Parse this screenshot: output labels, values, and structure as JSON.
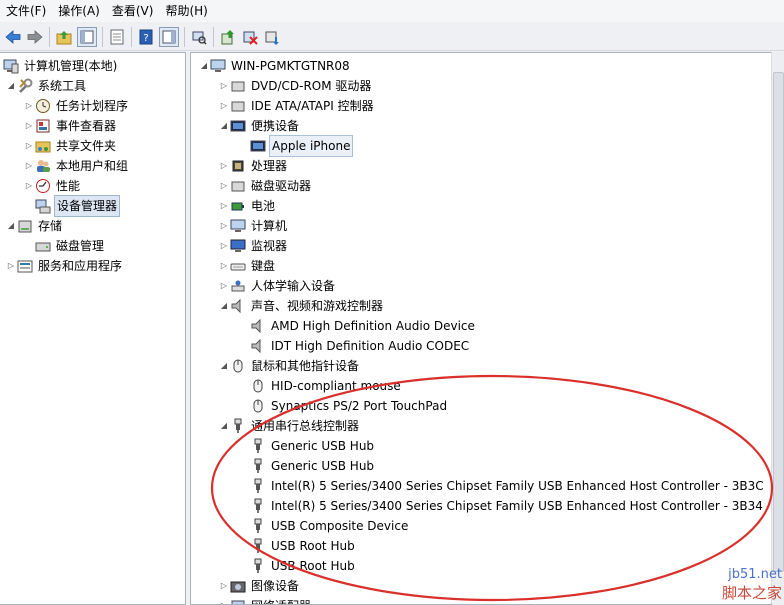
{
  "menu": [
    "文件(F)",
    "操作(A)",
    "查看(V)",
    "帮助(H)"
  ],
  "toolbar": {
    "icons": [
      "back-arrow-icon",
      "forward-arrow-icon",
      "up-folder-icon",
      "show-hide-tree-icon",
      "properties-icon",
      "help-icon",
      "action-pane-icon",
      "scan-hardware-icon",
      "update-driver-icon",
      "disable-device-icon",
      "uninstall-device-icon"
    ]
  },
  "left_tree": {
    "root": "计算机管理(本地)",
    "system_tools": "系统工具",
    "task_scheduler": "任务计划程序",
    "event_viewer": "事件查看器",
    "shared_folders": "共享文件夹",
    "local_users": "本地用户和组",
    "performance": "性能",
    "device_manager": "设备管理器",
    "storage": "存储",
    "disk_management": "磁盘管理",
    "services": "服务和应用程序"
  },
  "device_tree": {
    "computer": "WIN-PGMKTGTNR08",
    "categories": [
      {
        "label": "DVD/CD-ROM 驱动器",
        "expanded": false
      },
      {
        "label": "IDE ATA/ATAPI 控制器",
        "expanded": false
      },
      {
        "label": "便携设备",
        "expanded": true,
        "children": [
          "Apple iPhone"
        ]
      },
      {
        "label": "处理器",
        "expanded": false
      },
      {
        "label": "磁盘驱动器",
        "expanded": false
      },
      {
        "label": "电池",
        "expanded": false
      },
      {
        "label": "计算机",
        "expanded": false
      },
      {
        "label": "监视器",
        "expanded": false
      },
      {
        "label": "键盘",
        "expanded": false
      },
      {
        "label": "人体学输入设备",
        "expanded": false
      },
      {
        "label": "声音、视频和游戏控制器",
        "expanded": true,
        "children": [
          "AMD High Definition Audio Device",
          "IDT High Definition Audio CODEC"
        ]
      },
      {
        "label": "鼠标和其他指针设备",
        "expanded": true,
        "children": [
          "HID-compliant mouse",
          "Synaptics PS/2 Port TouchPad"
        ]
      },
      {
        "label": "通用串行总线控制器",
        "expanded": true,
        "children": [
          "Generic USB Hub",
          "Generic USB Hub",
          "Intel(R) 5 Series/3400 Series Chipset Family USB Enhanced Host Controller - 3B3C",
          "Intel(R) 5 Series/3400 Series Chipset Family USB Enhanced Host Controller - 3B34",
          "USB Composite Device",
          "USB Root Hub",
          "USB Root Hub"
        ]
      },
      {
        "label": "图像设备",
        "expanded": false
      },
      {
        "label": "网络适配器",
        "expanded": false
      }
    ],
    "selected": "Apple iPhone"
  },
  "annotation": {
    "color": "#d9302c"
  },
  "watermark": {
    "site": "jb51.net",
    "name": "脚本之家"
  }
}
